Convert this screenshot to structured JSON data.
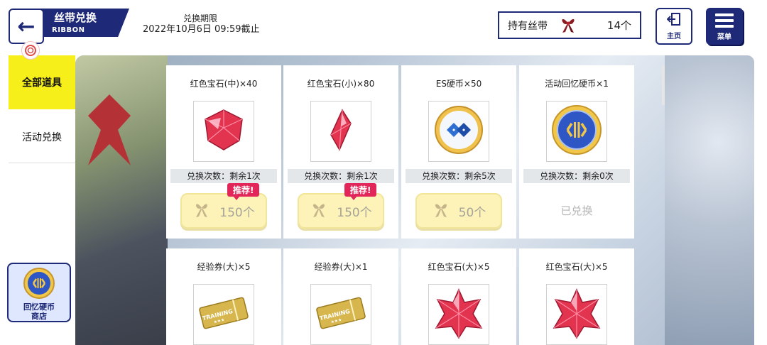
{
  "header": {
    "title": "丝带兑换",
    "subtitle": "RIBBON",
    "period_label": "兑换期限",
    "period_date": "2022年10月6日 09:59截止",
    "ribbon_label": "持有丝带",
    "ribbon_count": "14个",
    "home_label": "主页",
    "menu_label": "菜单"
  },
  "sidebar": {
    "tabs": [
      {
        "label": "全部道具",
        "active": true
      },
      {
        "label": "活动兑换",
        "active": false
      }
    ],
    "coin_shop_line1": "回忆硬币",
    "coin_shop_line2": "商店"
  },
  "items": [
    {
      "name": "红色宝石(中)×40",
      "remain": "兑换次数：剩余1次",
      "price": "150个",
      "recommend": "推荐!",
      "icon": "red-gem-medium"
    },
    {
      "name": "红色宝石(小)×80",
      "remain": "兑换次数：剩余1次",
      "price": "150个",
      "recommend": "推荐!",
      "icon": "red-gem-small"
    },
    {
      "name": "ES硬币×50",
      "remain": "兑换次数：剩余5次",
      "price": "50个",
      "icon": "es-coin"
    },
    {
      "name": "活动回忆硬币×1",
      "remain": "兑换次数：剩余0次",
      "status": "已兑换",
      "icon": "memory-coin"
    },
    {
      "name": "经验券(大)×5",
      "icon": "exp-ticket"
    },
    {
      "name": "经验券(大)×1",
      "icon": "exp-ticket"
    },
    {
      "name": "红色宝石(大)×5",
      "icon": "red-gem-large"
    },
    {
      "name": "红色宝石(大)×5",
      "icon": "red-gem-large"
    }
  ],
  "colors": {
    "navy": "#1e2a78",
    "active_tab": "#f7ef1a",
    "recommend": "#e2265a",
    "price_bg": "#fdf3b8"
  }
}
